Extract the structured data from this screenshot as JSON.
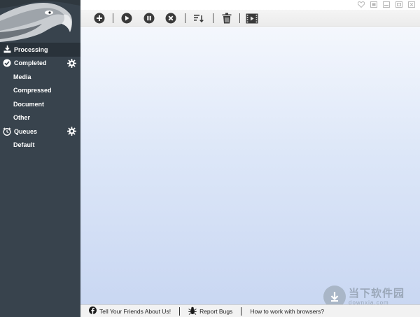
{
  "sidebar": {
    "logo": "eagle-logo",
    "items": [
      {
        "label": "Processing",
        "icon": "download-icon"
      },
      {
        "label": "Completed",
        "icon": "check-circle-icon"
      },
      {
        "label": "Media"
      },
      {
        "label": "Compressed"
      },
      {
        "label": "Document"
      },
      {
        "label": "Other"
      },
      {
        "label": "Queues",
        "icon": "clock-icon"
      },
      {
        "label": "Default"
      }
    ]
  },
  "toolbar": {
    "buttons": [
      "add-icon",
      "play-icon",
      "pause-icon",
      "stop-icon",
      "sort-icon",
      "trash-icon",
      "video-icon"
    ]
  },
  "footer": {
    "tell_friends": "Tell Your Friends About Us!",
    "report_bugs": "Report Bugs",
    "browsers": "How to work with browsers?"
  },
  "watermark": {
    "cn": "当下软件园",
    "url": "downxia.com"
  },
  "colors": {
    "sidebar_bg": "#38434d",
    "sidebar_active": "#29323a",
    "content_top": "#f4f7fd",
    "content_bottom": "#c9d7f2"
  }
}
